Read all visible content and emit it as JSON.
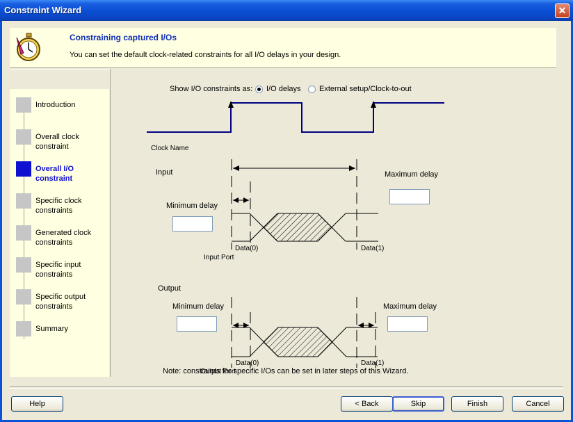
{
  "window": {
    "title": "Constraint Wizard"
  },
  "header": {
    "title": "Constraining captured I/Os",
    "subtitle": "You can set the default clock-related constraints for all I/O delays in your design."
  },
  "sidebar": {
    "items": [
      {
        "label": "Introduction",
        "active": false
      },
      {
        "label": "Overall clock constraint",
        "active": false
      },
      {
        "label": "Overall I/O constraint",
        "active": true
      },
      {
        "label": "Specific clock constraints",
        "active": false
      },
      {
        "label": "Generated clock constraints",
        "active": false
      },
      {
        "label": "Specific input constraints",
        "active": false
      },
      {
        "label": "Specific output constraints",
        "active": false
      },
      {
        "label": "Summary",
        "active": false
      }
    ]
  },
  "show_as": {
    "label": "Show I/O constraints as:",
    "options": [
      {
        "label": "I/O delays",
        "selected": true
      },
      {
        "label": "External setup/Clock-to-out",
        "selected": false
      }
    ]
  },
  "diagram": {
    "clock_name": "Clock Name",
    "input_section": "Input",
    "output_section": "Output",
    "input_min_label": "Minimum delay",
    "input_max_label": "Maximum delay",
    "output_min_label": "Minimum delay",
    "output_max_label": "Maximum delay",
    "data0": "Data(0)",
    "data1": "Data(1)",
    "input_port": "Input Port",
    "output_port": "Output Port"
  },
  "fields": {
    "input_min": "",
    "input_max": "",
    "output_min": "",
    "output_max": ""
  },
  "note": "Note: constraints for specific I/Os can be set in later steps of this Wizard.",
  "buttons": {
    "help": "Help",
    "back": "< Back",
    "skip": "Skip",
    "finish": "Finish",
    "cancel": "Cancel"
  },
  "colors": {
    "accent": "#1010d0",
    "signal": "#000080",
    "panel": "#ffffe1"
  }
}
